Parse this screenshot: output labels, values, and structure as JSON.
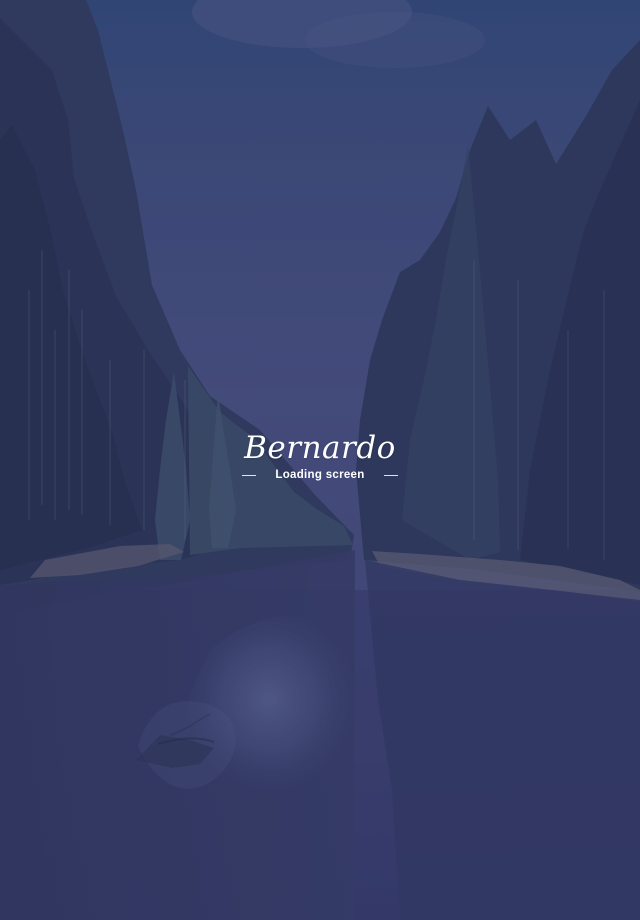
{
  "brand": {
    "name": "Bernardo"
  },
  "loading": {
    "label": "Loading screen"
  },
  "colors": {
    "overlay": "#343968",
    "sky": "#4a5c8a",
    "trees": "#2a3853",
    "water": "#353a63",
    "text": "#ffffff"
  },
  "background": {
    "icon": "forest-river-landscape-icon"
  }
}
